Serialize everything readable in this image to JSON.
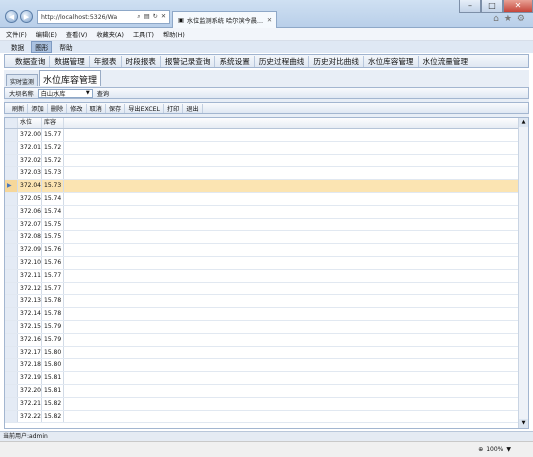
{
  "browser": {
    "address": "http://localhost:5326/Wa",
    "tab_title": "水位监测系统 哈尔滨今晨…",
    "zoom": "100%"
  },
  "menubar": [
    "文件(F)",
    "编辑(E)",
    "查看(V)",
    "收藏夹(A)",
    "工具(T)",
    "帮助(H)"
  ],
  "appmenu": [
    "数据",
    "图形",
    "帮助"
  ],
  "modules": [
    "数据查询",
    "数据管理",
    "年报表",
    "时段报表",
    "报警记录查询",
    "系统设置",
    "历史过程曲线",
    "历史对比曲线",
    "水位库容管理",
    "水位流量管理"
  ],
  "subtabs": [
    "实时监测",
    "水位库容管理"
  ],
  "filter": {
    "label": "大坝名称",
    "selected": "白山水库",
    "query": "查询"
  },
  "toolbar": [
    "刷新",
    "添加",
    "删除",
    "修改",
    "取消",
    "保存",
    "导出EXCEL",
    "打印",
    "退出"
  ],
  "grid": {
    "headers": [
      "水位",
      "库容"
    ],
    "rows": [
      [
        "372.00",
        "15.77"
      ],
      [
        "372.01",
        "15.72"
      ],
      [
        "372.02",
        "15.72"
      ],
      [
        "372.03",
        "15.73"
      ],
      [
        "372.04",
        "15.73"
      ],
      [
        "372.05",
        "15.74"
      ],
      [
        "372.06",
        "15.74"
      ],
      [
        "372.07",
        "15.75"
      ],
      [
        "372.08",
        "15.75"
      ],
      [
        "372.09",
        "15.76"
      ],
      [
        "372.10",
        "15.76"
      ],
      [
        "372.11",
        "15.77"
      ],
      [
        "372.12",
        "15.77"
      ],
      [
        "372.13",
        "15.78"
      ],
      [
        "372.14",
        "15.78"
      ],
      [
        "372.15",
        "15.79"
      ],
      [
        "372.16",
        "15.79"
      ],
      [
        "372.17",
        "15.80"
      ],
      [
        "372.18",
        "15.80"
      ],
      [
        "372.19",
        "15.81"
      ],
      [
        "372.20",
        "15.81"
      ],
      [
        "372.21",
        "15.82"
      ],
      [
        "372.22",
        "15.82"
      ]
    ],
    "selected_index": 4
  },
  "status": "当前用户:admin"
}
